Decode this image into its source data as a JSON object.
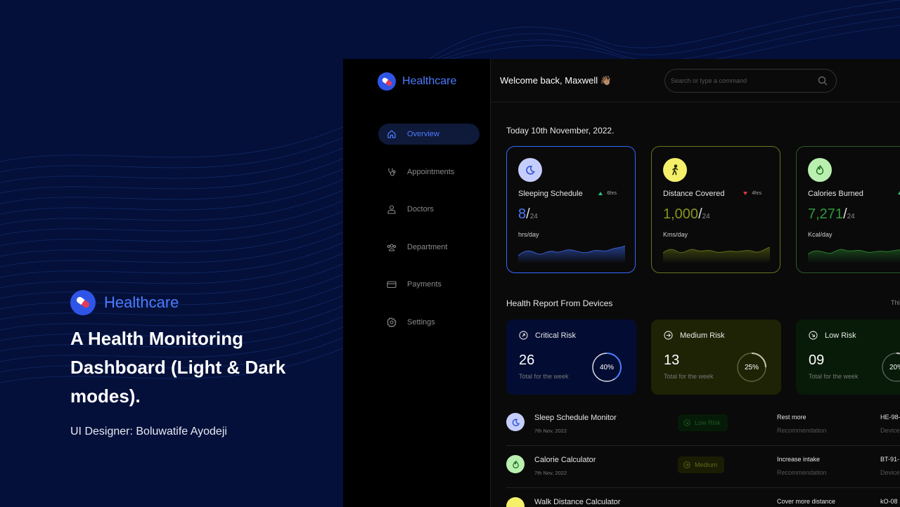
{
  "promo": {
    "brand": "Healthcare",
    "title": "A Health Monitoring Dashboard (Light & Dark modes).",
    "credit": "UI Designer: Boluwatife Ayodeji"
  },
  "sidebar": {
    "brand": "Healthcare",
    "items": [
      {
        "label": "Overview",
        "icon": "home-icon",
        "active": true
      },
      {
        "label": "Appointments",
        "icon": "stethoscope-icon"
      },
      {
        "label": "Doctors",
        "icon": "doctor-icon"
      },
      {
        "label": "Department",
        "icon": "department-icon"
      },
      {
        "label": "Payments",
        "icon": "card-icon"
      },
      {
        "label": "Settings",
        "icon": "gear-icon"
      }
    ]
  },
  "header": {
    "welcome": "Welcome back, Maxwell 👋🏽",
    "search_placeholder": "Search or type a command"
  },
  "main": {
    "date": "Today 10th November, 2022.",
    "stats": [
      {
        "name": "Sleeping Schedule",
        "trend": "6hrs",
        "trend_dir": "up",
        "value": "8",
        "of": "24",
        "unit": "hrs/day",
        "color": "#4b7bff"
      },
      {
        "name": "Distance Covered",
        "trend": "4hrs",
        "trend_dir": "down",
        "value": "1,000",
        "of": "24",
        "unit": "Kms/day",
        "color": "#8a961c"
      },
      {
        "name": "Calories Burned",
        "trend": "",
        "trend_dir": "up",
        "value": "7,271",
        "of": "24",
        "unit": "Kcal/day",
        "color": "#2e9a3a"
      }
    ],
    "report_title": "Health Report From Devices",
    "report_link": "Thi",
    "risks": [
      {
        "label": "Critical Risk",
        "count": "26",
        "sub": "Total for the week",
        "percent": 40,
        "percent_label": "40%",
        "color": "#4b7bff"
      },
      {
        "label": "Medium Risk",
        "count": "13",
        "sub": "Total for the week",
        "percent": 25,
        "percent_label": "25%",
        "color": "#c8c8a8"
      },
      {
        "label": "Low Risk",
        "count": "09",
        "sub": "Total for the week",
        "percent": 20,
        "percent_label": "20%",
        "color": "#c8c8c8"
      }
    ],
    "rows": [
      {
        "name": "Sleep Schedule Monitor",
        "date": "7th Nov, 2022",
        "badge": "Low Risk",
        "rec": "Rest more",
        "rec_sub": "Recommendation",
        "device": "HE-98-",
        "device_sub": "Device"
      },
      {
        "name": "Calorie Calculator",
        "date": "7th Nov, 2022",
        "badge": "Medium",
        "rec": "Increase intake",
        "rec_sub": "Recommendation",
        "device": "BT-91-",
        "device_sub": "Device"
      },
      {
        "name": "Walk Distance Calculator",
        "date": "",
        "badge": "",
        "rec": "Cover more distance",
        "rec_sub": "",
        "device": "kO-08",
        "device_sub": ""
      }
    ]
  }
}
